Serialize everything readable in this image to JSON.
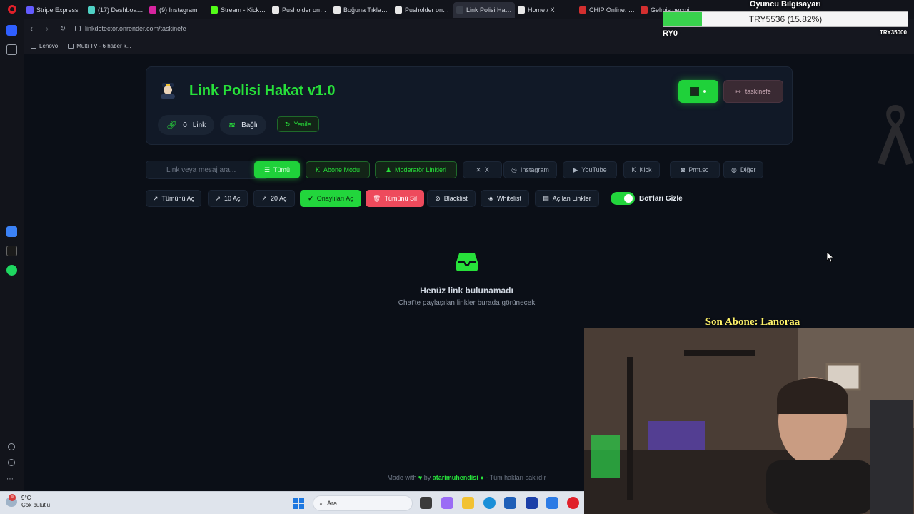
{
  "browser": {
    "tabs": [
      {
        "label": "Stripe Express",
        "color": "#635bff"
      },
      {
        "label": "(17) Dashboard / S",
        "color": "#4fd1c5"
      },
      {
        "label": "(9) Instagram",
        "color": "#d6249f"
      },
      {
        "label": "Stream - Kick Dash",
        "color": "#53fc18"
      },
      {
        "label": "Pusholder on X: \"Y",
        "color": "#e8e8e8"
      },
      {
        "label": "Boğuna Tıklama or",
        "color": "#e8e8e8"
      },
      {
        "label": "Pusholder on X: \"C",
        "color": "#e8e8e8"
      },
      {
        "label": "Link Polisi Hakat v1.0",
        "color": "#3a3f4a"
      },
      {
        "label": "Home / X",
        "color": "#e8e8e8"
      },
      {
        "label": "CHIP Online: Bilişi",
        "color": "#d32f2f"
      },
      {
        "label": "Gelmiş geçmiş en",
        "color": "#d32f2f"
      }
    ],
    "active_tab_index": 7,
    "url": "linkdetector.onrender.com/taskinefe",
    "bookmarks": [
      "Lenovo",
      "Multi TV - 6 haber k..."
    ]
  },
  "app": {
    "title": "Link Polisi Hakat v1.0",
    "link_count": "0",
    "link_label": "Link",
    "connection_label": "Bağlı",
    "refresh_label": "Yenile",
    "username": "taskinefe",
    "search_placeholder": "Link veya mesaj ara...",
    "filters": [
      {
        "label": "Tümü",
        "state": "on"
      },
      {
        "label": "Abone Modu",
        "state": "green"
      },
      {
        "label": "Moderatör Linkleri",
        "state": "green"
      },
      {
        "label": "X",
        "state": "off"
      },
      {
        "label": "Instagram",
        "state": "off"
      },
      {
        "label": "YouTube",
        "state": "off"
      },
      {
        "label": "Kick",
        "state": "off"
      },
      {
        "label": "Prnt.sc",
        "state": "off"
      },
      {
        "label": "Diğer",
        "state": "off"
      }
    ],
    "actions": [
      {
        "label": "Tümünü Aç",
        "style": "plain"
      },
      {
        "label": "10 Aç",
        "style": "plain"
      },
      {
        "label": "20 Aç",
        "style": "plain"
      },
      {
        "label": "Onaylıları Aç",
        "style": "ok"
      },
      {
        "label": "Tümünü Sil",
        "style": "del"
      },
      {
        "label": "Blacklist",
        "style": "plain"
      },
      {
        "label": "Whitelist",
        "style": "plain"
      },
      {
        "label": "Açılan Linkler",
        "style": "plain"
      }
    ],
    "toggle_label": "Bot'ları Gizle",
    "toggle_on": true,
    "empty_title": "Henüz link bulunamadı",
    "empty_subtitle": "Chat'te paylaşılan linkler burada görünecek",
    "footer_prefix": "Made with",
    "footer_by": "by",
    "footer_author": "atarimuhendisi",
    "footer_suffix": "- Tüm hakları saklıdır",
    "accent_color": "#27e03a"
  },
  "overlay": {
    "title": "Oyuncu Bilgisayarı",
    "progress_text": "TRY5536 (15.82%)",
    "progress_fraction": 0.1582,
    "start_label": "RY0",
    "end_label": "TRY35000",
    "last_sub_label": "Son Abone: Lanoraa"
  },
  "taskbar": {
    "temperature": "9°C",
    "weather": "Çok bulutlu",
    "notification_count": "9",
    "search_label": "Ara"
  }
}
